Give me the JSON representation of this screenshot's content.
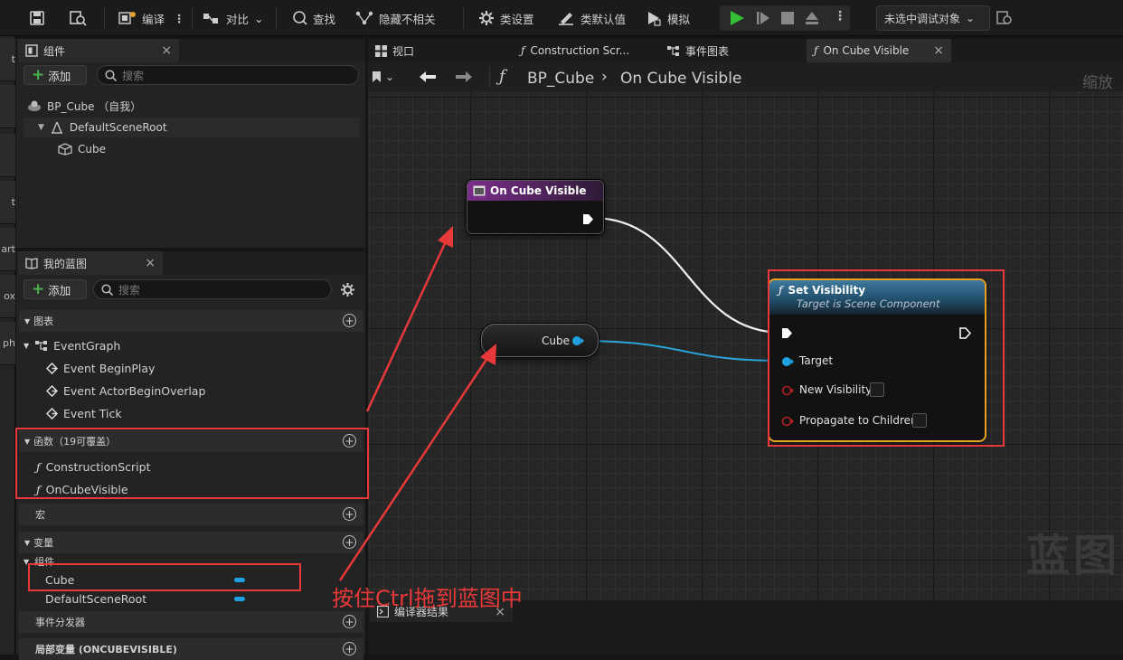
{
  "toolbar": {
    "compile": "编译",
    "diff": "对比",
    "find": "查找",
    "hide_unrelated": "隐藏不相关",
    "class_settings": "类设置",
    "class_defaults": "类默认值",
    "simulate": "模拟",
    "debug_object": "未选中调试对象"
  },
  "left_strip": {
    "tabs": [
      "t",
      "art",
      "ox",
      "ph"
    ]
  },
  "components_panel": {
    "title": "组件",
    "add_label": "添加",
    "search_placeholder": "搜索",
    "tree": {
      "self": "BP_Cube （自我）",
      "root": "DefaultSceneRoot",
      "child": "Cube"
    }
  },
  "my_blueprint_panel": {
    "title": "我的蓝图",
    "add_label": "添加",
    "search_placeholder": "搜索",
    "sections": {
      "graphs": "图表",
      "event_graph": "EventGraph",
      "events": [
        "Event BeginPlay",
        "Event ActorBeginOverlap",
        "Event Tick"
      ],
      "functions": "函数（19可覆盖）",
      "function_items": [
        "ConstructionScript",
        "OnCubeVisible"
      ],
      "macros": "宏",
      "variables": "变量",
      "components_group": "组件",
      "variable_items": [
        "Cube",
        "DefaultSceneRoot"
      ],
      "dispatchers": "事件分发器",
      "local_vars": "局部变量 (ONCUBEVISIBLE)"
    }
  },
  "editor_tabs": [
    {
      "label": "视口"
    },
    {
      "label": "Construction Scr..."
    },
    {
      "label": "事件图表"
    },
    {
      "label": "On Cube Visible"
    }
  ],
  "breadcrumb": {
    "blueprint": "BP_Cube",
    "function": "On Cube Visible",
    "zoom": "缩放"
  },
  "nodes": {
    "entry": {
      "title": "On Cube Visible"
    },
    "cube_var": {
      "label": "Cube"
    },
    "set_visibility": {
      "title": "Set Visibility",
      "subtitle": "Target is Scene Component",
      "pins": [
        "Target",
        "New Visibility",
        "Propagate to Children"
      ]
    }
  },
  "annotation": "按住Ctrl拖到蓝图中",
  "watermark": "蓝图",
  "compiler_results_tab": "编译器结果",
  "colors": {
    "annotation_red": "#e8393a",
    "entry_header": "#7a2e8a",
    "function_header": "#2f5f80",
    "object_pin": "#1fa0e0",
    "bool_pin": "#9a1a1a",
    "selection_orange": "#e8a020",
    "play_green": "#35c135"
  },
  "icons": [
    "save-icon",
    "browse-icon",
    "compile-icon",
    "diff-icon",
    "find-icon",
    "hide-unrelated-icon",
    "class-settings-icon",
    "class-defaults-icon",
    "simulate-icon",
    "play-icon",
    "step-icon",
    "stop-icon",
    "eject-icon",
    "settings-gear-icon",
    "function-icon",
    "back-arrow-icon",
    "forward-arrow-icon"
  ]
}
